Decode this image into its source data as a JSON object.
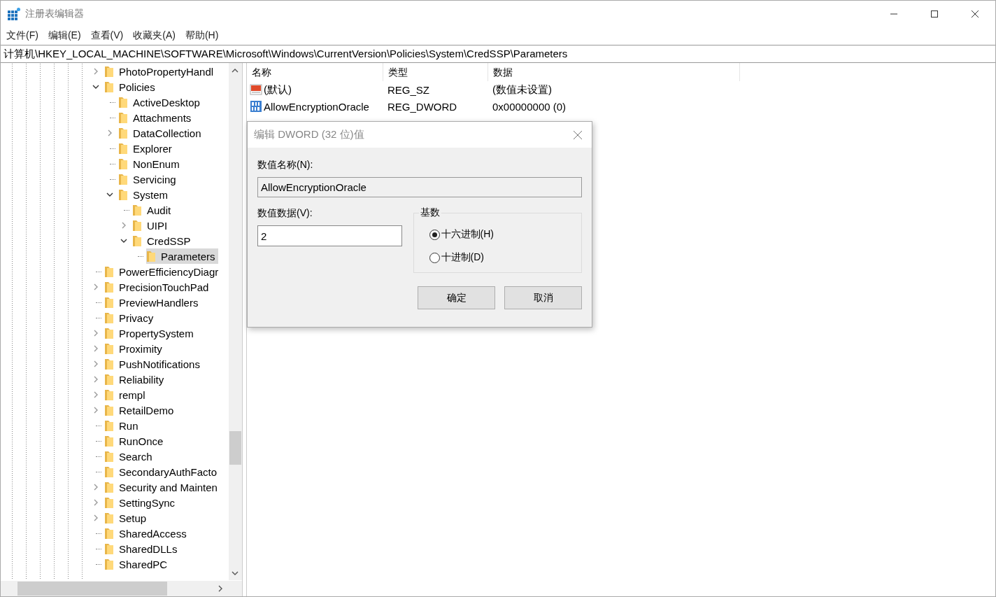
{
  "window": {
    "title": "注册表编辑器"
  },
  "menu": [
    "文件(F)",
    "编辑(E)",
    "查看(V)",
    "收藏夹(A)",
    "帮助(H)"
  ],
  "address": "计算机\\HKEY_LOCAL_MACHINE\\SOFTWARE\\Microsoft\\Windows\\CurrentVersion\\Policies\\System\\CredSSP\\Parameters",
  "tree": [
    {
      "label": "PhotoPropertyHandl",
      "kind": "branch",
      "expanded": false,
      "selected": false
    },
    {
      "label": "Policies",
      "kind": "branch",
      "expanded": true,
      "selected": false,
      "children": [
        {
          "label": "ActiveDesktop",
          "kind": "leaf",
          "selected": false
        },
        {
          "label": "Attachments",
          "kind": "leaf",
          "selected": false
        },
        {
          "label": "DataCollection",
          "kind": "branch",
          "expanded": false,
          "selected": false
        },
        {
          "label": "Explorer",
          "kind": "leaf",
          "selected": false
        },
        {
          "label": "NonEnum",
          "kind": "leaf",
          "selected": false
        },
        {
          "label": "Servicing",
          "kind": "leaf",
          "selected": false
        },
        {
          "label": "System",
          "kind": "branch",
          "expanded": true,
          "selected": false,
          "children": [
            {
              "label": "Audit",
              "kind": "leaf",
              "selected": false
            },
            {
              "label": "UIPI",
              "kind": "branch",
              "expanded": false,
              "selected": false
            },
            {
              "label": "CredSSP",
              "kind": "branch",
              "expanded": true,
              "selected": false,
              "children": [
                {
                  "label": "Parameters",
                  "kind": "leaf",
                  "selected": true
                }
              ]
            }
          ]
        }
      ]
    },
    {
      "label": "PowerEfficiencyDiagr",
      "kind": "leaf",
      "selected": false
    },
    {
      "label": "PrecisionTouchPad",
      "kind": "branch",
      "expanded": false,
      "selected": false
    },
    {
      "label": "PreviewHandlers",
      "kind": "leaf",
      "selected": false
    },
    {
      "label": "Privacy",
      "kind": "leaf",
      "selected": false
    },
    {
      "label": "PropertySystem",
      "kind": "branch",
      "expanded": false,
      "selected": false
    },
    {
      "label": "Proximity",
      "kind": "branch",
      "expanded": false,
      "selected": false
    },
    {
      "label": "PushNotifications",
      "kind": "branch",
      "expanded": false,
      "selected": false
    },
    {
      "label": "Reliability",
      "kind": "branch",
      "expanded": false,
      "selected": false
    },
    {
      "label": "rempl",
      "kind": "branch",
      "expanded": false,
      "selected": false
    },
    {
      "label": "RetailDemo",
      "kind": "branch",
      "expanded": false,
      "selected": false
    },
    {
      "label": "Run",
      "kind": "leaf",
      "selected": false
    },
    {
      "label": "RunOnce",
      "kind": "leaf",
      "selected": false
    },
    {
      "label": "Search",
      "kind": "leaf",
      "selected": false
    },
    {
      "label": "SecondaryAuthFacto",
      "kind": "leaf",
      "selected": false
    },
    {
      "label": "Security and Mainten",
      "kind": "branch",
      "expanded": false,
      "selected": false
    },
    {
      "label": "SettingSync",
      "kind": "branch",
      "expanded": false,
      "selected": false
    },
    {
      "label": "Setup",
      "kind": "branch",
      "expanded": false,
      "selected": false
    },
    {
      "label": "SharedAccess",
      "kind": "leaf",
      "selected": false
    },
    {
      "label": "SharedDLLs",
      "kind": "leaf",
      "selected": false
    },
    {
      "label": "SharedPC",
      "kind": "leaf",
      "selected": false
    }
  ],
  "values_list": {
    "columns": [
      "名称",
      "类型",
      "数据"
    ],
    "rows": [
      {
        "kind": "string",
        "name": "(默认)",
        "type": "REG_SZ",
        "data": "(数值未设置)"
      },
      {
        "kind": "binary",
        "name": "AllowEncryptionOracle",
        "type": "REG_DWORD",
        "data": "0x00000000 (0)"
      }
    ]
  },
  "dialog": {
    "title": "编辑 DWORD (32 位)值",
    "name_label": "数值名称(N):",
    "name_value": "AllowEncryptionOracle",
    "data_label": "数值数据(V):",
    "data_value": "2",
    "base_label": "基数",
    "bases": [
      {
        "label": "十六进制(H)",
        "selected": true
      },
      {
        "label": "十进制(D)",
        "selected": false
      }
    ],
    "buttons": [
      "确定",
      "取消"
    ]
  }
}
